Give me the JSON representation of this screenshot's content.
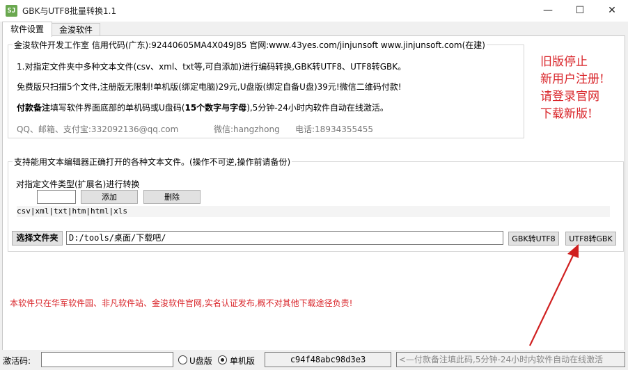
{
  "window": {
    "title": "GBK与UTF8批量转换1.1",
    "icon_text": "SJ",
    "minimize": "—",
    "maximize": "☐",
    "close": "✕"
  },
  "tabs": [
    {
      "label": "软件设置",
      "active": true
    },
    {
      "label": "金浚软件",
      "active": false
    }
  ],
  "info": {
    "legend": "金浚软件开发工作室 信用代码(广东):92440605MA4X049J85 官网:www.43yes.com/jinjunsoft  www.jinjunsoft.com(在建)",
    "line1": "1.对指定文件夹中多种文本文件(csv、xml、txt等,可自添加)进行编码转换,GBK转UTF8、UTF8转GBK。",
    "line2": "免费版只扫描5个文件,注册版无限制!单机版(绑定电脑)29元,U盘版(绑定自备U盘)39元!微信二维码付款!",
    "line3_bold": "付款备注",
    "line3_rest": "填写软件界面底部的单机码或U盘码(",
    "line3_bold2": "15个数字与字母",
    "line3_end": "),5分钟-24小时内软件自动在线激活。",
    "contact_qq": "QQ、邮箱、支付宝:332092136@qq.com",
    "contact_wechat": "微信:hangzhong",
    "contact_phone": "电话:18934355455"
  },
  "notice": {
    "line1": "旧版停止",
    "line2": "新用户注册!",
    "line3": "请登录官网",
    "line4": "下载新版!"
  },
  "convert": {
    "legend": "支持能用文本编辑器正确打开的各种文本文件。(操作不可逆,操作前请备份)",
    "ext_label": "对指定文件类型(扩展名)进行转换",
    "ext_input": "",
    "add_button": "添加",
    "delete_button": "删除",
    "ext_list": "csv|xml|txt|htm|html|xls",
    "select_folder_button": "选择文件夹",
    "folder_path": "D:/tools/桌面/下载吧/",
    "gbk_to_utf8_button": "GBK转UTF8",
    "utf8_to_gbk_button": "UTF8转GBK"
  },
  "footer_notice": "本软件只在华军软件园、非凡软件站、金浚软件官网,实名认证发布,概不对其他下载途径负责!",
  "bottom": {
    "activation_label": "激活码:",
    "activation_value": "",
    "usb_label": "U盘版",
    "usb_selected": false,
    "standalone_label": "单机版",
    "standalone_selected": true,
    "machine_code": "c94f48abc98d3e3",
    "hint": "<—付款备注填此码,5分钟-24小时内软件自动在线激活"
  },
  "colors": {
    "notice_red": "#d9252a",
    "arrow_red": "#d02020"
  }
}
